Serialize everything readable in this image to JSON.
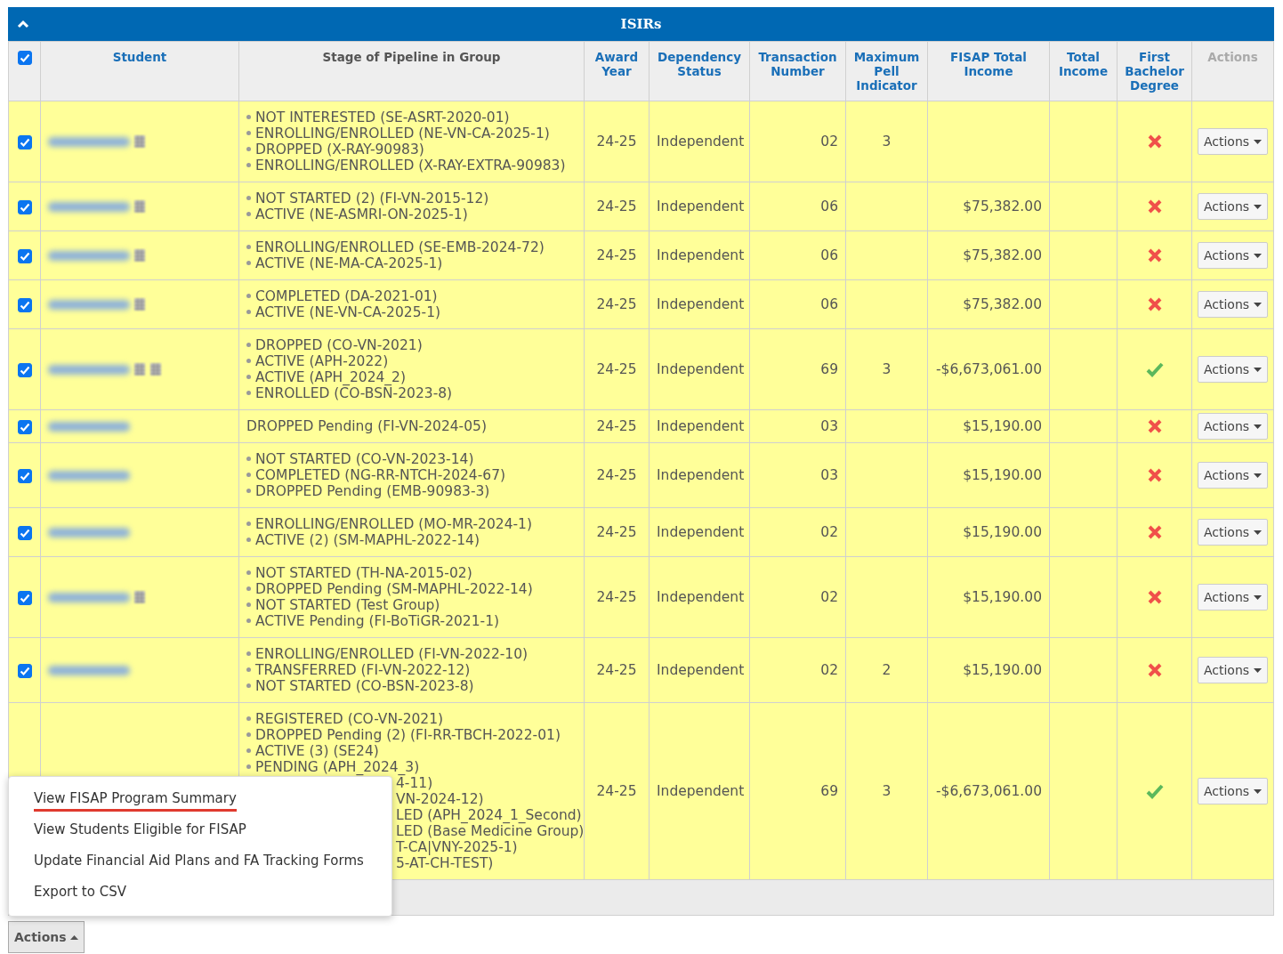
{
  "panel": {
    "title": "ISIRs",
    "expanded": true
  },
  "select_all": {
    "checked": true
  },
  "columns": [
    {
      "label": "Student",
      "kind": "link"
    },
    {
      "label": "Stage of Pipeline in Group",
      "kind": "plain"
    },
    {
      "label": "Award Year",
      "kind": "link"
    },
    {
      "label": "Dependency Status",
      "kind": "link"
    },
    {
      "label": "Transaction Number",
      "kind": "link"
    },
    {
      "label": "Maximum Pell Indicator",
      "kind": "link"
    },
    {
      "label": "FISAP Total Income",
      "kind": "link"
    },
    {
      "label": "Total Income",
      "kind": "link"
    },
    {
      "label": "First Bachelor Degree",
      "kind": "link"
    },
    {
      "label": "Actions",
      "kind": "disabled"
    }
  ],
  "rows": [
    {
      "checked": true,
      "student": {
        "redacted": true,
        "icons": [
          {
            "kind": "calendar"
          }
        ]
      },
      "stage": [
        {
          "text": "NOT INTERESTED (SE-ASRT-2020-01)",
          "kind": "bullet"
        },
        {
          "text": "ENROLLING/ENROLLED (NE-VN-CA-2025-1)",
          "kind": "bullet"
        },
        {
          "text": "DROPPED (X-RAY-90983)",
          "kind": "bullet"
        },
        {
          "text": "ENROLLING/ENROLLED (X-RAY-EXTRA-90983)",
          "kind": "bullet"
        }
      ],
      "award_year": "24-25",
      "dependency": "Independent",
      "transaction": "02",
      "max_pell": "3",
      "fisap_income": "",
      "total_income": "",
      "first_bachelor": false,
      "action": "Actions"
    },
    {
      "checked": true,
      "student": {
        "redacted": true,
        "icons": [
          {
            "kind": "calendar"
          }
        ]
      },
      "stage": [
        {
          "text": "NOT STARTED (2) (FI-VN-2015-12)",
          "kind": "bullet"
        },
        {
          "text": "ACTIVE (NE-ASMRI-ON-2025-1)",
          "kind": "bullet"
        }
      ],
      "award_year": "24-25",
      "dependency": "Independent",
      "transaction": "06",
      "max_pell": "",
      "fisap_income": "$75,382.00",
      "total_income": "",
      "first_bachelor": false,
      "action": "Actions"
    },
    {
      "checked": true,
      "student": {
        "redacted": true,
        "icons": [
          {
            "kind": "calendar"
          }
        ]
      },
      "stage": [
        {
          "text": "ENROLLING/ENROLLED (SE-EMB-2024-72)",
          "kind": "bullet"
        },
        {
          "text": "ACTIVE (NE-MA-CA-2025-1)",
          "kind": "bullet"
        }
      ],
      "award_year": "24-25",
      "dependency": "Independent",
      "transaction": "06",
      "max_pell": "",
      "fisap_income": "$75,382.00",
      "total_income": "",
      "first_bachelor": false,
      "action": "Actions"
    },
    {
      "checked": true,
      "student": {
        "redacted": true,
        "icons": [
          {
            "kind": "calendar"
          }
        ]
      },
      "stage": [
        {
          "text": "COMPLETED (DA-2021-01)",
          "kind": "bullet"
        },
        {
          "text": "ACTIVE (NE-VN-CA-2025-1)",
          "kind": "bullet"
        }
      ],
      "award_year": "24-25",
      "dependency": "Independent",
      "transaction": "06",
      "max_pell": "",
      "fisap_income": "$75,382.00",
      "total_income": "",
      "first_bachelor": false,
      "action": "Actions"
    },
    {
      "checked": true,
      "student": {
        "redacted": true,
        "icons": [
          {
            "kind": "calendar"
          },
          {
            "kind": "calendar"
          }
        ]
      },
      "stage": [
        {
          "text": "DROPPED (CO-VN-2021)",
          "kind": "bullet"
        },
        {
          "text": "ACTIVE (APH-2022)",
          "kind": "bullet"
        },
        {
          "text": "ACTIVE (APH_2024_2)",
          "kind": "bullet"
        },
        {
          "text": "ENROLLED (CO-BSN-2023-8)",
          "kind": "bullet"
        }
      ],
      "award_year": "24-25",
      "dependency": "Independent",
      "transaction": "69",
      "max_pell": "3",
      "fisap_income": "-$6,673,061.00",
      "total_income": "",
      "first_bachelor": true,
      "action": "Actions"
    },
    {
      "checked": true,
      "student": {
        "redacted": true
      },
      "stage": [
        {
          "text": "DROPPED Pending (FI-VN-2024-05)",
          "kind": "plain"
        }
      ],
      "award_year": "24-25",
      "dependency": "Independent",
      "transaction": "03",
      "max_pell": "",
      "fisap_income": "$15,190.00",
      "total_income": "",
      "first_bachelor": false,
      "action": "Actions"
    },
    {
      "checked": true,
      "student": {
        "redacted": true
      },
      "stage": [
        {
          "text": "NOT STARTED (CO-VN-2023-14)",
          "kind": "bullet"
        },
        {
          "text": "COMPLETED (NG-RR-NTCH-2024-67)",
          "kind": "bullet"
        },
        {
          "text": "DROPPED Pending (EMB-90983-3)",
          "kind": "bullet"
        }
      ],
      "award_year": "24-25",
      "dependency": "Independent",
      "transaction": "03",
      "max_pell": "",
      "fisap_income": "$15,190.00",
      "total_income": "",
      "first_bachelor": false,
      "action": "Actions"
    },
    {
      "checked": true,
      "student": {
        "redacted": true
      },
      "stage": [
        {
          "text": "ENROLLING/ENROLLED (MO-MR-2024-1)",
          "kind": "bullet"
        },
        {
          "text": "ACTIVE (2) (SM-MAPHL-2022-14)",
          "kind": "bullet"
        }
      ],
      "award_year": "24-25",
      "dependency": "Independent",
      "transaction": "02",
      "max_pell": "",
      "fisap_income": "$15,190.00",
      "total_income": "",
      "first_bachelor": false,
      "action": "Actions"
    },
    {
      "checked": true,
      "student": {
        "redacted": true,
        "icons": [
          {
            "kind": "calendar"
          }
        ]
      },
      "stage": [
        {
          "text": "NOT STARTED (TH-NA-2015-02)",
          "kind": "bullet"
        },
        {
          "text": "DROPPED Pending (SM-MAPHL-2022-14)",
          "kind": "bullet"
        },
        {
          "text": "NOT STARTED (Test Group)",
          "kind": "bullet"
        },
        {
          "text": "ACTIVE Pending (FI-BoTiGR-2021-1)",
          "kind": "bullet"
        }
      ],
      "award_year": "24-25",
      "dependency": "Independent",
      "transaction": "02",
      "max_pell": "",
      "fisap_income": "$15,190.00",
      "total_income": "",
      "first_bachelor": false,
      "action": "Actions"
    },
    {
      "checked": true,
      "student": {
        "redacted": true
      },
      "stage": [
        {
          "text": "ENROLLING/ENROLLED (FI-VN-2022-10)",
          "kind": "bullet"
        },
        {
          "text": "TRANSFERRED (FI-VN-2022-12)",
          "kind": "bullet"
        },
        {
          "text": "NOT STARTED (CO-BSN-2023-8)",
          "kind": "bullet"
        }
      ],
      "award_year": "24-25",
      "dependency": "Independent",
      "transaction": "02",
      "max_pell": "2",
      "fisap_income": "$15,190.00",
      "total_income": "",
      "first_bachelor": false,
      "action": "Actions"
    },
    {
      "stage": [
        {
          "text": "REGISTERED (CO-VN-2021)",
          "kind": "bullet"
        },
        {
          "text": "DROPPED Pending (2) (FI-RR-TBCH-2022-01)",
          "kind": "bullet"
        },
        {
          "text": "ACTIVE (3) (SE24)",
          "kind": "bullet"
        },
        {
          "text": "PENDING (APH_2024_3)",
          "kind": "bullet"
        },
        {
          "text": "4-11)",
          "kind": "covered"
        },
        {
          "text": "VN-2024-12)",
          "kind": "covered"
        },
        {
          "text": "LED (APH_2024_1_Second)",
          "kind": "covered"
        },
        {
          "text": "LED (Base Medicine Group)",
          "kind": "covered"
        },
        {
          "text": "T-CA|VNY-2025-1)",
          "kind": "covered"
        },
        {
          "text": "5-AT-CH-TEST)",
          "kind": "covered"
        }
      ],
      "award_year": "24-25",
      "dependency": "Independent",
      "transaction": "69",
      "max_pell": "3",
      "fisap_income": "-$6,673,061.00",
      "total_income": "",
      "first_bachelor": true,
      "action": "Actions"
    }
  ],
  "bulk_actions": {
    "label": "Actions",
    "expanded": true,
    "menu": [
      {
        "label": "View FISAP Program Summary",
        "highlighted": true
      },
      {
        "label": "View Students Eligible for FISAP",
        "highlighted": false
      },
      {
        "label": "Update Financial Aid Plans and FA Tracking Forms",
        "highlighted": false
      },
      {
        "label": "Export to CSV",
        "highlighted": false
      }
    ]
  }
}
